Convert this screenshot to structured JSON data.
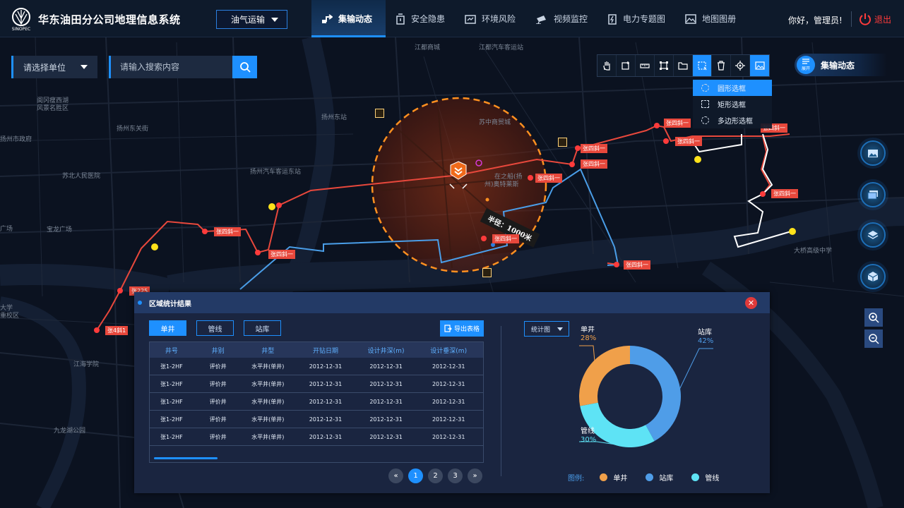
{
  "header": {
    "title": "华东油田分公司地理信息系统",
    "module_select": "油气运输",
    "nav": [
      {
        "label": "集输动态",
        "icon": "pipeline-icon",
        "active": true
      },
      {
        "label": "安全隐患",
        "icon": "hazard-icon",
        "active": false
      },
      {
        "label": "环境风险",
        "icon": "environment-icon",
        "active": false
      },
      {
        "label": "视频监控",
        "icon": "camera-icon",
        "active": false
      },
      {
        "label": "电力专题图",
        "icon": "power-icon",
        "active": false
      },
      {
        "label": "地图图册",
        "icon": "map-album-icon",
        "active": false
      }
    ],
    "greeting": "你好，管理员!",
    "logout": "退出"
  },
  "search": {
    "unit_placeholder": "请选择单位",
    "placeholder": "请输入搜索内容"
  },
  "toolbar": {
    "tools": [
      "pan-icon",
      "add-point-icon",
      "measure-icon",
      "area-icon",
      "folder-icon",
      "box-select-icon",
      "delete-icon",
      "locate-icon",
      "image-icon"
    ],
    "select_menu": [
      "圆形选框",
      "矩形选框",
      "多边形选框"
    ]
  },
  "panel_tag": {
    "badge": "展开",
    "title": "集输动态"
  },
  "map": {
    "labels": [
      "江都商城",
      "江都汽车客运站",
      "阆冈瘦西湖",
      "风景名胜区",
      "扬州东站",
      "苏中商贸城",
      "扬州东关街",
      "扬州市政府",
      "苏北人民医院",
      "扬州汽车客运东站",
      "宝龙广场",
      "广场",
      "大学",
      "重校区",
      "江海学院",
      "九龙湖公园",
      "大桥高级中学",
      "在之船(扬",
      "州)奥特莱斯"
    ],
    "radius_label": "半径：1000米",
    "well_tag": "张四斜一",
    "well_tag_2": "张4斜1",
    "well_tag_3": "张225"
  },
  "stats": {
    "title": "区域统计结果",
    "tabs": [
      "单井",
      "管线",
      "站库"
    ],
    "export": "导出表格",
    "columns": [
      "井号",
      "井别",
      "井型",
      "开钻日期",
      "设计井深(m)",
      "设计垂深(m)"
    ],
    "rows": [
      [
        "张1-2HF",
        "评价井",
        "水平井(单井)",
        "2012-12-31",
        "2012-12-31",
        "2012-12-31"
      ],
      [
        "张1-2HF",
        "评价井",
        "水平井(单井)",
        "2012-12-31",
        "2012-12-31",
        "2012-12-31"
      ],
      [
        "张1-2HF",
        "评价井",
        "水平井(单井)",
        "2012-12-31",
        "2012-12-31",
        "2012-12-31"
      ],
      [
        "张1-2HF",
        "评价井",
        "水平井(单井)",
        "2012-12-31",
        "2012-12-31",
        "2012-12-31"
      ],
      [
        "张1-2HF",
        "评价井",
        "水平井(单井)",
        "2012-12-31",
        "2012-12-31",
        "2012-12-31"
      ]
    ],
    "pages": [
      "1",
      "2",
      "3"
    ],
    "current_page": "1",
    "chart_select": "统计图",
    "legend_label": "图例:"
  },
  "chart_data": {
    "type": "pie",
    "categories": [
      "单井",
      "站库",
      "管线"
    ],
    "values": [
      28,
      42,
      30
    ],
    "value_labels": [
      "28%",
      "42%",
      "30%"
    ],
    "colors": [
      "#f0a04a",
      "#4f9de8",
      "#5ee3f5"
    ]
  }
}
